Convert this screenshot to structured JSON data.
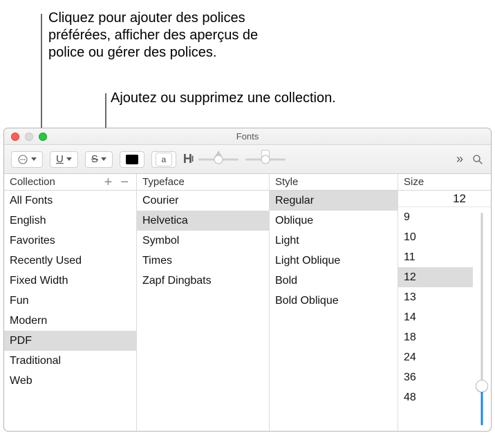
{
  "annotations": {
    "top": "Cliquez pour ajouter des polices préférées, afficher des aperçus de police ou gérer des polices.",
    "second": "Ajoutez ou supprimez une collection."
  },
  "window": {
    "title": "Fonts"
  },
  "toolbar": {
    "more_icon": "more-icon",
    "underline_letter": "U",
    "strike_letter": "S",
    "sample_glyph": "a",
    "paragraph_glyph": "H",
    "chevrons": "»"
  },
  "headers": {
    "collection": "Collection",
    "typeface": "Typeface",
    "style": "Style",
    "size": "Size"
  },
  "collections": [
    {
      "label": "All Fonts",
      "selected": false
    },
    {
      "label": "English",
      "selected": false
    },
    {
      "label": "Favorites",
      "selected": false
    },
    {
      "label": "Recently Used",
      "selected": false
    },
    {
      "label": "Fixed Width",
      "selected": false
    },
    {
      "label": "Fun",
      "selected": false
    },
    {
      "label": "Modern",
      "selected": false
    },
    {
      "label": "PDF",
      "selected": true
    },
    {
      "label": "Traditional",
      "selected": false
    },
    {
      "label": "Web",
      "selected": false
    }
  ],
  "typefaces": [
    {
      "label": "Courier",
      "selected": false
    },
    {
      "label": "Helvetica",
      "selected": true
    },
    {
      "label": "Symbol",
      "selected": false
    },
    {
      "label": "Times",
      "selected": false
    },
    {
      "label": "Zapf Dingbats",
      "selected": false
    }
  ],
  "styles": [
    {
      "label": "Regular",
      "selected": true
    },
    {
      "label": "Oblique",
      "selected": false
    },
    {
      "label": "Light",
      "selected": false
    },
    {
      "label": "Light Oblique",
      "selected": false
    },
    {
      "label": "Bold",
      "selected": false
    },
    {
      "label": "Bold Oblique",
      "selected": false
    }
  ],
  "size_value": "12",
  "sizes": [
    {
      "label": "9",
      "selected": false
    },
    {
      "label": "10",
      "selected": false
    },
    {
      "label": "11",
      "selected": false
    },
    {
      "label": "12",
      "selected": true
    },
    {
      "label": "13",
      "selected": false
    },
    {
      "label": "14",
      "selected": false
    },
    {
      "label": "18",
      "selected": false
    },
    {
      "label": "24",
      "selected": false
    },
    {
      "label": "36",
      "selected": false
    },
    {
      "label": "48",
      "selected": false
    }
  ]
}
